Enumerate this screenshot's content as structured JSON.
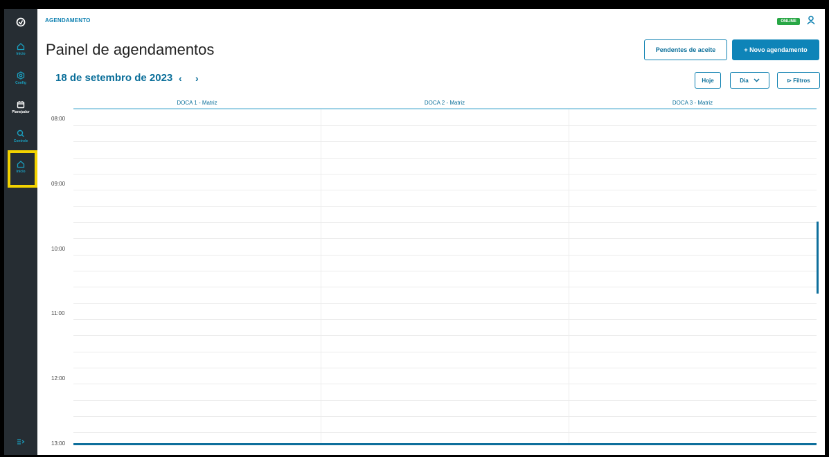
{
  "sidebar": {
    "items": [
      {
        "label": "Início"
      },
      {
        "label": "Config"
      },
      {
        "label": "Planejador"
      },
      {
        "label": "Controle"
      },
      {
        "label": "Início"
      }
    ]
  },
  "header": {
    "app_title": "AGENDAMENTO",
    "status": "ONLINE"
  },
  "main": {
    "title": "Painel de agendamentos",
    "pending_button": "Pendentes de aceite",
    "new_button": "+ Novo agendamento",
    "date": "18 de setembro de 2023",
    "today_button": "Hoje",
    "view_select": "Dia",
    "filters_button": "⊳ Filtros"
  },
  "calendar": {
    "columns": [
      "DOCA 1 - Matriz",
      "DOCA 2 - Matriz",
      "DOCA 3 - Matriz"
    ],
    "times": [
      "08:00",
      "09:00",
      "10:00",
      "11:00",
      "12:00",
      "13:00"
    ]
  },
  "colors": {
    "accent": "#0e84b8",
    "sidebar": "#262d33",
    "online": "#28a745",
    "highlight": "#f3d300"
  }
}
